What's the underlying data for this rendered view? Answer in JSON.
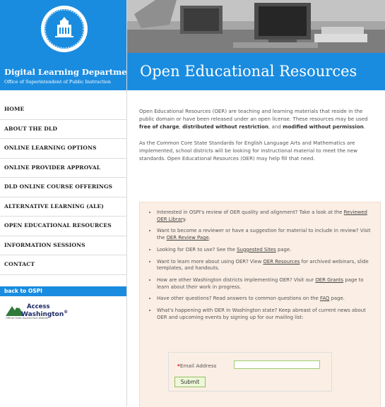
{
  "brand": {
    "department": "Digital Learning Department",
    "office": "Office of Superintendent of Public Instruction"
  },
  "nav": [
    {
      "label": "HOME"
    },
    {
      "label": "ABOUT THE DLD"
    },
    {
      "label": "ONLINE LEARNING OPTIONS"
    },
    {
      "label": "ONLINE PROVIDER APPROVAL"
    },
    {
      "label": "DLD ONLINE COURSE OFFERINGS"
    },
    {
      "label": "ALTERNATIVE LEARNING (ALE)"
    },
    {
      "label": "OPEN EDUCATIONAL RESOURCES"
    },
    {
      "label": "INFORMATION SESSIONS"
    },
    {
      "label": "CONTACT"
    }
  ],
  "back_link": "back to OSPI",
  "access_washington": {
    "line1": "Access",
    "line2": "Washington",
    "tagline": "Official State Government Website"
  },
  "page_title": "Open Educational Resources",
  "intro": {
    "p1_a": "Open Educational Resources (OER) are teaching and learning materials that reside in the public domain or have been released under an open license. These resources may be used ",
    "p1_b1": "free of charge",
    "p1_c": ", ",
    "p1_b2": "distributed without restriction",
    "p1_d": ", and ",
    "p1_b3": "modified without permission",
    "p1_e": ".",
    "p2": "As the Common Core State Standards for English Language Arts and Mathematics are implemented, school districts will be looking for instructional material to meet the new standards. Open Educational Resources (OER) may help fill that need."
  },
  "bullets": [
    {
      "pre": "Interested in OSPI's review of OER quality and alignment? Take a look at the ",
      "link": "Reviewed OER Library",
      "post": "."
    },
    {
      "pre": "Want to become a reviewer or have a suggestion for material to include in review? Visit the ",
      "link": "OER Review Page",
      "post": "."
    },
    {
      "pre": "Looking for OER to use? See the ",
      "link": "Suggested Sites",
      "post": " page."
    },
    {
      "pre": "Want to learn more about using OER? View ",
      "link": "OER Resources",
      "post": " for archived webinars, slide templates, and handouts."
    },
    {
      "pre": "How are other Washington districts implementing OER? Visit our ",
      "link": "OER Grants",
      "post": " page to learn about their work in progress."
    },
    {
      "pre": "Have other questions? Read answers to common questions on the ",
      "link": "FAQ",
      "post": " page."
    },
    {
      "pre": "What's happening with OER in Washington state? Keep abreast of current news about OER and upcoming events by signing up for our mailing list:",
      "link": "",
      "post": ""
    }
  ],
  "form": {
    "required_mark": "*",
    "email_label": "Email Address",
    "email_value": "",
    "submit_label": "Submit"
  },
  "colors": {
    "accent": "#1a8ce0",
    "panel": "#fbeee4"
  }
}
